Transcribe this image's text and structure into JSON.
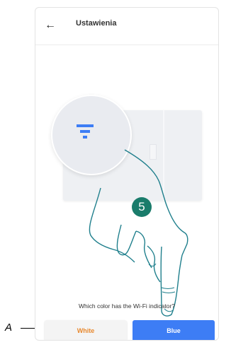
{
  "header": {
    "back_icon": "arrow-left-icon",
    "title": "Ustawienia"
  },
  "illustration": {
    "step_number": "5",
    "filter_icon": "wifi-indicator-icon"
  },
  "question": "Which color has the Wi-Fi indicator?",
  "buttons": {
    "white_label": "White",
    "blue_label": "Blue"
  },
  "callout": {
    "label": "A"
  },
  "colors": {
    "blue": "#3d7df5",
    "orange": "#e8892f",
    "teal": "#1a7c6b"
  }
}
